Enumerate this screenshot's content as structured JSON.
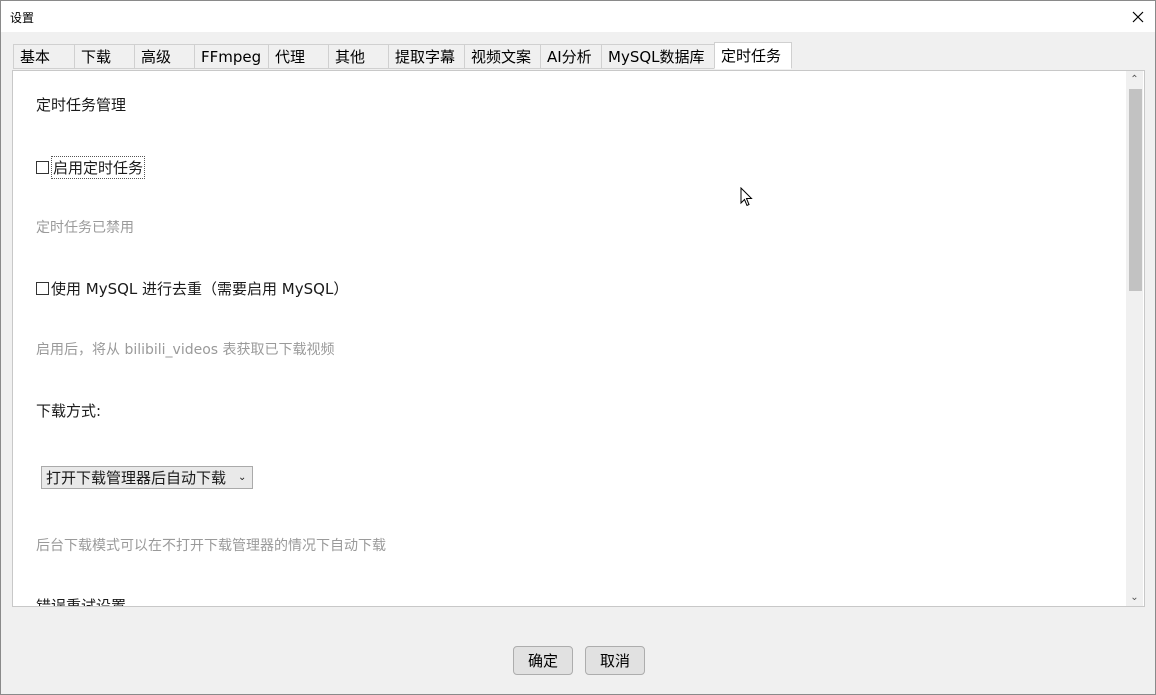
{
  "window": {
    "title": "设置"
  },
  "tabs": [
    {
      "label": "基本"
    },
    {
      "label": "下载"
    },
    {
      "label": "高级"
    },
    {
      "label": "FFmpeg"
    },
    {
      "label": "代理"
    },
    {
      "label": "其他"
    },
    {
      "label": "提取字幕"
    },
    {
      "label": "视频文案"
    },
    {
      "label": "AI分析"
    },
    {
      "label": "MySQL数据库"
    },
    {
      "label": "定时任务"
    }
  ],
  "active_tab": "定时任务",
  "scheduler": {
    "section_title": "定时任务管理",
    "enable_label": "启用定时任务",
    "enable_checked": false,
    "status_text": "定时任务已禁用",
    "mysql_dedupe_label": "使用 MySQL 进行去重（需要启用 MySQL）",
    "mysql_dedupe_checked": false,
    "mysql_hint": "启用后，将从 bilibili_videos 表获取已下载视频",
    "download_mode_label": "下载方式:",
    "download_mode_value": "打开下载管理器后自动下载",
    "download_mode_hint": "后台下载模式可以在不打开下载管理器的情况下自动下载",
    "retry_section_label": "错误重试设置"
  },
  "buttons": {
    "ok": "确定",
    "cancel": "取消"
  }
}
